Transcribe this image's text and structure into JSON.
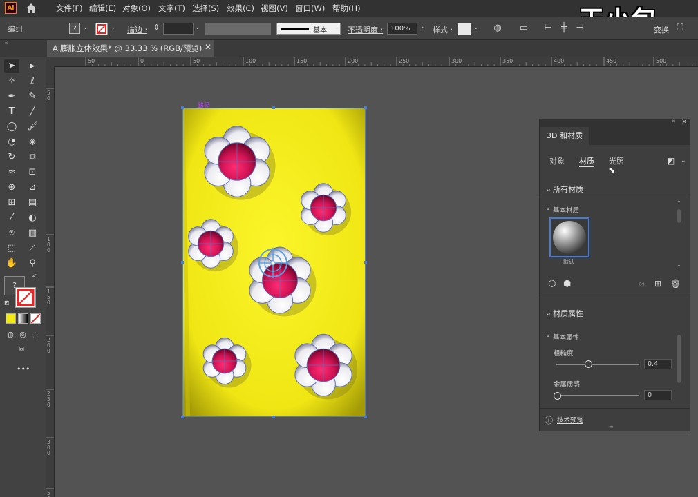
{
  "menubar": {
    "logo": "Ai",
    "items": [
      "文件(F)",
      "编辑(E)",
      "对象(O)",
      "文字(T)",
      "选择(S)",
      "效果(C)",
      "视图(V)",
      "窗口(W)",
      "帮助(H)"
    ],
    "watermark": "王小包"
  },
  "controlbar": {
    "selection_label": "编组",
    "fill_label": "?",
    "stroke_label": "描边 :",
    "brush_label": "基本",
    "opacity_label": "不透明度 :",
    "opacity_value": "100%",
    "style_label": "样式 :",
    "transform_label": "变换"
  },
  "document": {
    "tab_label": "Ai膨胀立体效果* @ 33.33 % (RGB/预览)",
    "close": "✕",
    "path_label": "路径",
    "colors": {
      "yellow": "#f2ea14",
      "pink": "#e2185a",
      "selection": "#4a7bd4"
    }
  },
  "rulers": {
    "h_labels": [
      "50",
      "0",
      "50",
      "100",
      "150",
      "200",
      "250",
      "300",
      "350",
      "400",
      "450",
      "500"
    ],
    "v_labels": [
      "5\n0",
      "1\n0\n0",
      "1\n5\n0",
      "2\n0\n0",
      "2\n5\n0",
      "3\n0\n0",
      "5\n0"
    ]
  },
  "toolbar": {
    "tools": [
      "selection-tool",
      "direct-selection-tool",
      "magic-wand-tool",
      "lasso-tool",
      "pen-tool",
      "curvature-tool",
      "type-tool",
      "line-tool",
      "ellipse-tool",
      "paintbrush-tool",
      "shaper-tool",
      "eraser-tool",
      "rotate-tool",
      "scale-tool",
      "warp-tool",
      "free-transform-tool",
      "shape-builder-tool",
      "perspective-grid-tool",
      "mesh-tool",
      "gradient-tool",
      "eyedropper-tool",
      "blend-tool",
      "symbol-sprayer-tool",
      "column-graph-tool",
      "artboard-tool",
      "slice-tool",
      "hand-tool",
      "zoom-tool"
    ],
    "fill_question": "?",
    "more": "•••"
  },
  "panel": {
    "title": "3D 和材质",
    "tabs": [
      "对象",
      "材质",
      "光照"
    ],
    "active_tab": "材质",
    "all_materials": "所有材质",
    "basic_materials": "基本材质",
    "default_label": "默认",
    "material_props": "材质属性",
    "basic_props": "基本属性",
    "roughness_label": "粗糙度",
    "roughness_value": "0.4",
    "metallic_label": "金属质感",
    "metallic_value": "0",
    "preview_label": "技术预览"
  }
}
